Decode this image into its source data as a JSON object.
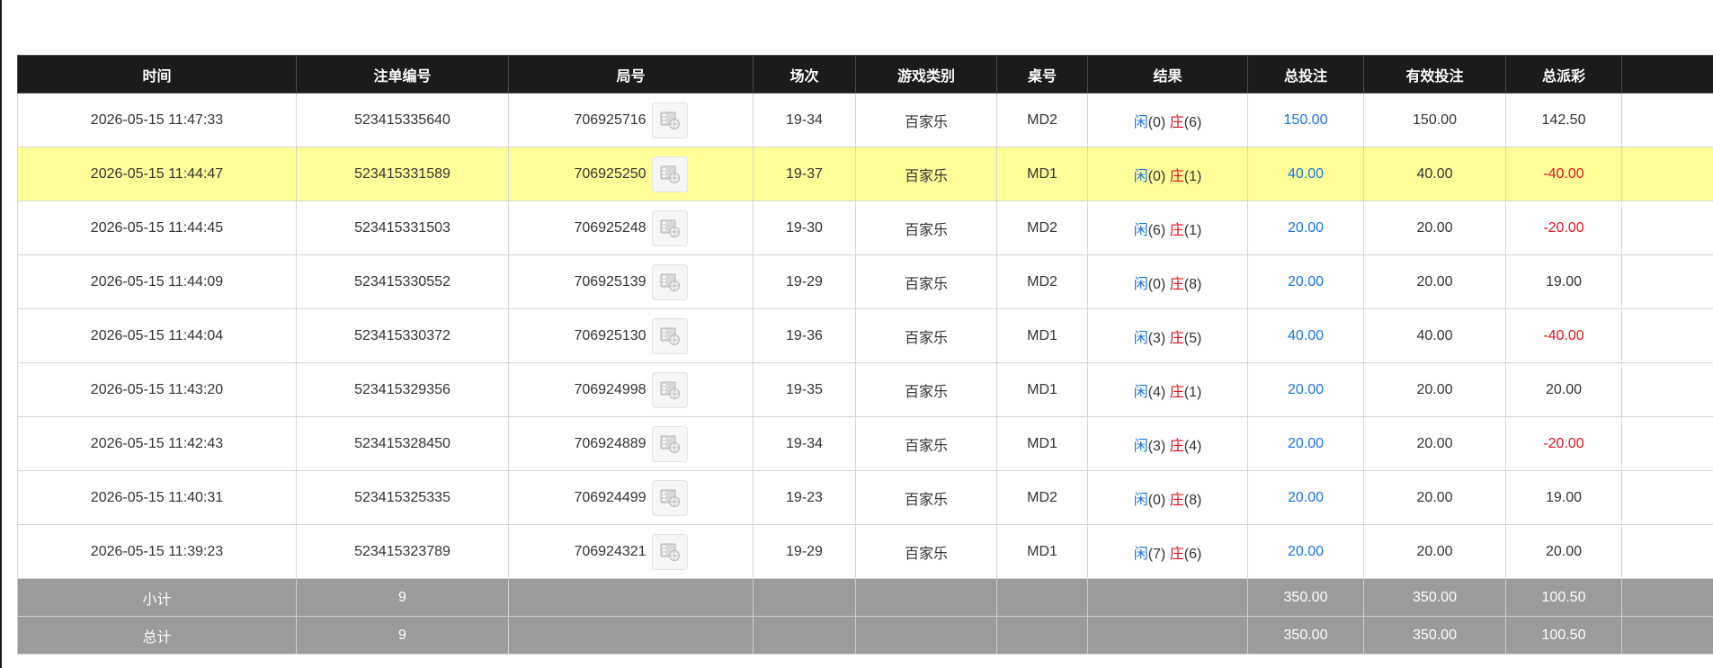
{
  "columns": [
    "时间",
    "注单编号",
    "局号",
    "场次",
    "游戏类别",
    "桌号",
    "结果",
    "总投注",
    "有效投注",
    "总派彩",
    ""
  ],
  "rows": [
    {
      "time": "2026-05-15 11:47:33",
      "bet_id": "523415335640",
      "round": "706925716",
      "shoe": "19-34",
      "game": "百家乐",
      "table": "MD2",
      "player_label": "闲",
      "player_score": "(0)",
      "banker_label": "庄",
      "banker_score": "(6)",
      "total_bet": "150.00",
      "valid_bet": "150.00",
      "payout": "142.50",
      "payout_neg": false,
      "highlight": false
    },
    {
      "time": "2026-05-15 11:44:47",
      "bet_id": "523415331589",
      "round": "706925250",
      "shoe": "19-37",
      "game": "百家乐",
      "table": "MD1",
      "player_label": "闲",
      "player_score": "(0)",
      "banker_label": "庄",
      "banker_score": "(1)",
      "total_bet": "40.00",
      "valid_bet": "40.00",
      "payout": "-40.00",
      "payout_neg": true,
      "highlight": true
    },
    {
      "time": "2026-05-15 11:44:45",
      "bet_id": "523415331503",
      "round": "706925248",
      "shoe": "19-30",
      "game": "百家乐",
      "table": "MD2",
      "player_label": "闲",
      "player_score": "(6)",
      "banker_label": "庄",
      "banker_score": "(1)",
      "total_bet": "20.00",
      "valid_bet": "20.00",
      "payout": "-20.00",
      "payout_neg": true,
      "highlight": false
    },
    {
      "time": "2026-05-15 11:44:09",
      "bet_id": "523415330552",
      "round": "706925139",
      "shoe": "19-29",
      "game": "百家乐",
      "table": "MD2",
      "player_label": "闲",
      "player_score": "(0)",
      "banker_label": "庄",
      "banker_score": "(8)",
      "total_bet": "20.00",
      "valid_bet": "20.00",
      "payout": "19.00",
      "payout_neg": false,
      "highlight": false
    },
    {
      "time": "2026-05-15 11:44:04",
      "bet_id": "523415330372",
      "round": "706925130",
      "shoe": "19-36",
      "game": "百家乐",
      "table": "MD1",
      "player_label": "闲",
      "player_score": "(3)",
      "banker_label": "庄",
      "banker_score": "(5)",
      "total_bet": "40.00",
      "valid_bet": "40.00",
      "payout": "-40.00",
      "payout_neg": true,
      "highlight": false
    },
    {
      "time": "2026-05-15 11:43:20",
      "bet_id": "523415329356",
      "round": "706924998",
      "shoe": "19-35",
      "game": "百家乐",
      "table": "MD1",
      "player_label": "闲",
      "player_score": "(4)",
      "banker_label": "庄",
      "banker_score": "(1)",
      "total_bet": "20.00",
      "valid_bet": "20.00",
      "payout": "20.00",
      "payout_neg": false,
      "highlight": false
    },
    {
      "time": "2026-05-15 11:42:43",
      "bet_id": "523415328450",
      "round": "706924889",
      "shoe": "19-34",
      "game": "百家乐",
      "table": "MD1",
      "player_label": "闲",
      "player_score": "(3)",
      "banker_label": "庄",
      "banker_score": "(4)",
      "total_bet": "20.00",
      "valid_bet": "20.00",
      "payout": "-20.00",
      "payout_neg": true,
      "highlight": false
    },
    {
      "time": "2026-05-15 11:40:31",
      "bet_id": "523415325335",
      "round": "706924499",
      "shoe": "19-23",
      "game": "百家乐",
      "table": "MD2",
      "player_label": "闲",
      "player_score": "(0)",
      "banker_label": "庄",
      "banker_score": "(8)",
      "total_bet": "20.00",
      "valid_bet": "20.00",
      "payout": "19.00",
      "payout_neg": false,
      "highlight": false
    },
    {
      "time": "2026-05-15 11:39:23",
      "bet_id": "523415323789",
      "round": "706924321",
      "shoe": "19-29",
      "game": "百家乐",
      "table": "MD1",
      "player_label": "闲",
      "player_score": "(7)",
      "banker_label": "庄",
      "banker_score": "(6)",
      "total_bet": "20.00",
      "valid_bet": "20.00",
      "payout": "20.00",
      "payout_neg": false,
      "highlight": false
    }
  ],
  "subtotal": {
    "label": "小计",
    "count": "9",
    "total_bet": "350.00",
    "valid_bet": "350.00",
    "payout": "100.50"
  },
  "grandtotal": {
    "label": "总计",
    "count": "9",
    "total_bet": "350.00",
    "valid_bet": "350.00",
    "payout": "100.50"
  },
  "icons": {
    "round_video": "video-replay-icon"
  },
  "colors": {
    "header_bg": "#1b1b1b",
    "highlight_row": "#ffff99",
    "footer_bg": "#9b9b9b",
    "positive_blue": "#1a73e8",
    "negative_red": "#e8101a"
  }
}
